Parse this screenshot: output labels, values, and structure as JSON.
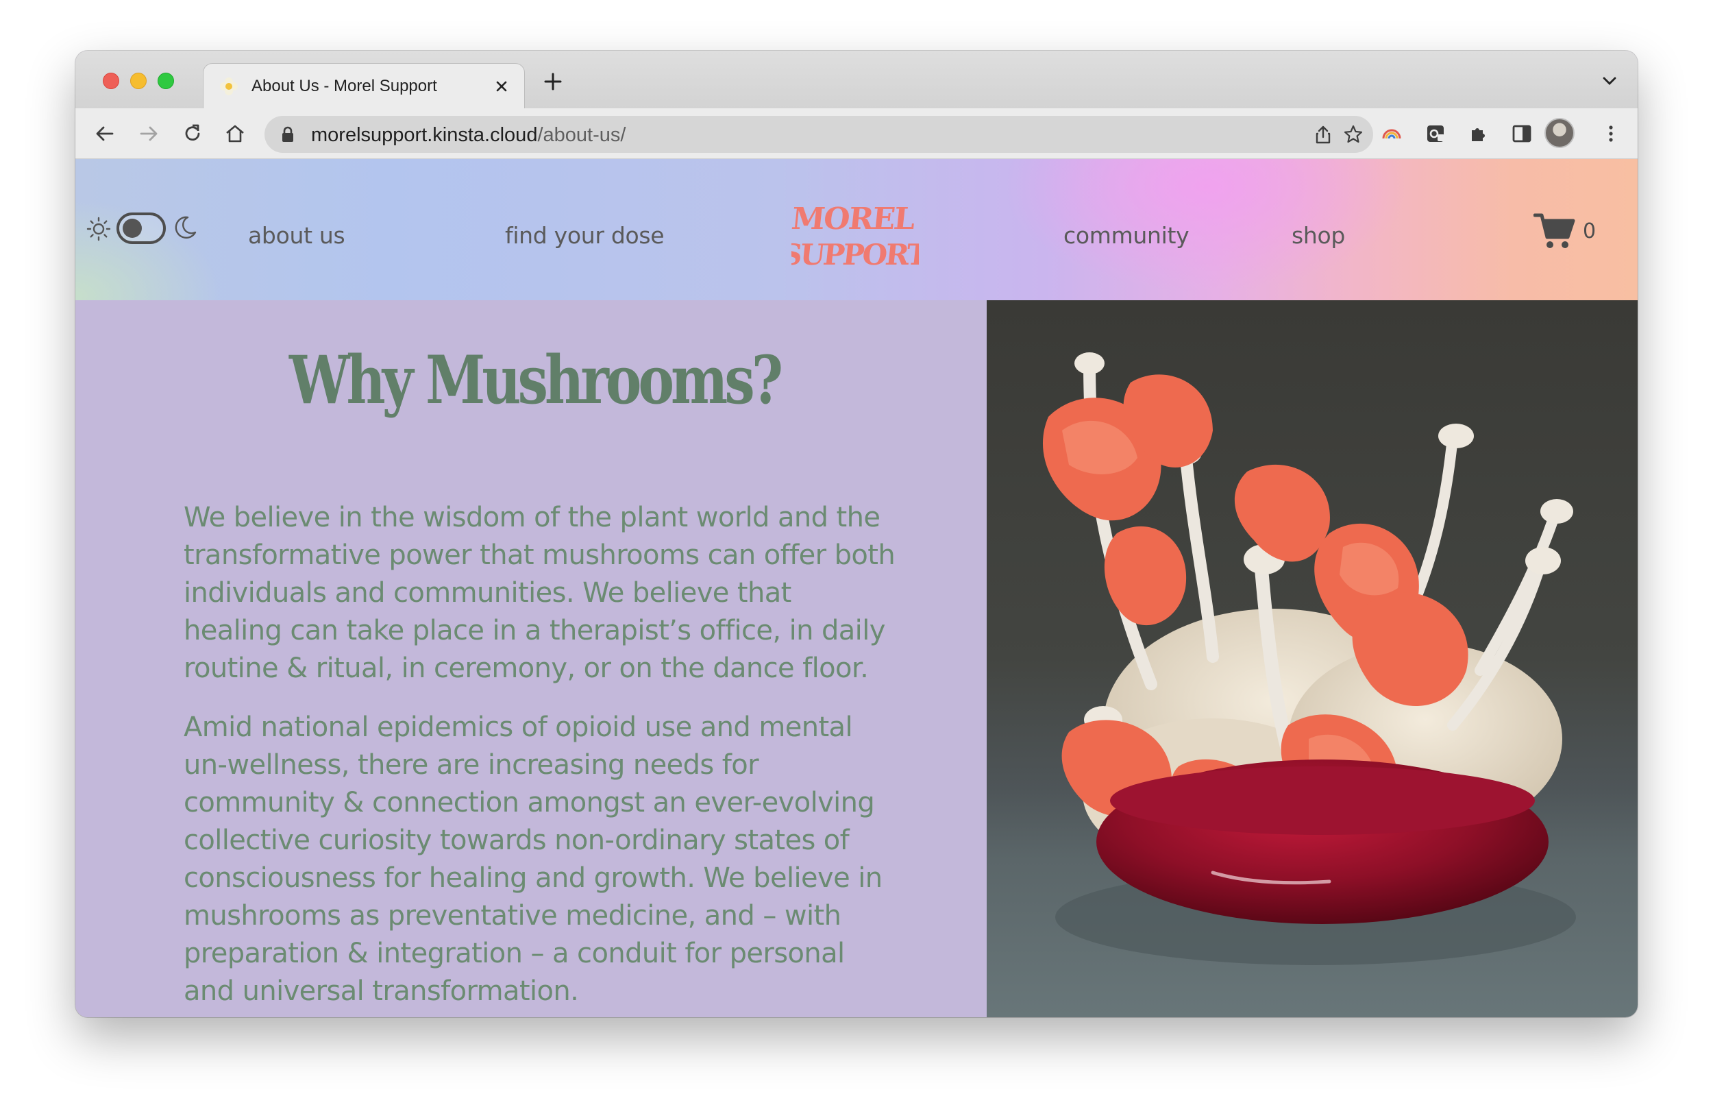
{
  "browser": {
    "tab_title": "About Us - Morel Support",
    "url_host": "morelsupport.kinsta.cloud",
    "url_path": "/about-us/"
  },
  "header": {
    "nav": {
      "about": "about us",
      "dose": "find your dose",
      "community": "community",
      "shop": "shop"
    },
    "logo_text": "MOREL SUPPORT",
    "cart_count": "0"
  },
  "main": {
    "heading": "Why Mushrooms?",
    "paragraph_1": "We believe in the wisdom of the plant world and the transformative power that mushrooms can offer both individuals and communities. We believe that healing can take place in a therapist’s office, in daily routine & ritual, in ceremony, or on the dance floor.",
    "paragraph_2": "Amid national epidemics of opioid use and mental un-wellness, there are increasing needs for community & connection amongst an ever-evolving collective curiosity towards non-ordinary states of consciousness for healing and growth. We believe in mushrooms as preventative medicine, and – with preparation & integration – a conduit for personal and universal transformation."
  },
  "colors": {
    "heading": "#617f69",
    "body_text": "#6b8b72",
    "panel_bg": "#c3b8da",
    "logo": "#f07a70"
  },
  "icons": [
    "back-icon",
    "forward-icon",
    "reload-icon",
    "home-icon",
    "lock-icon",
    "share-icon",
    "star-icon",
    "extension-icon",
    "sidebar-icon",
    "menu-icon",
    "sun-icon",
    "moon-icon",
    "cart-icon"
  ]
}
